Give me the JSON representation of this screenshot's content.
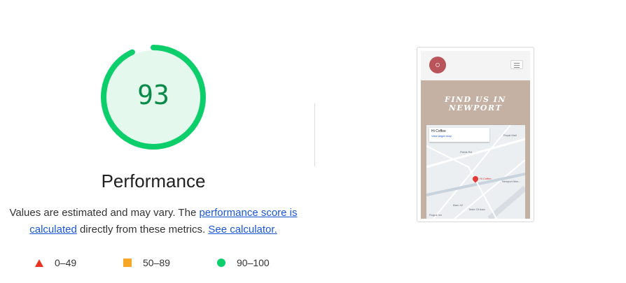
{
  "score": "93",
  "category_title": "Performance",
  "colors": {
    "pass": "#0cce6b",
    "pass_text": "#0a8a48",
    "pass_bg": "#e5f8ee",
    "average": "#f7a628",
    "fail": "#eb3323",
    "link": "#1a56d6"
  },
  "gauge": {
    "fraction": 0.93
  },
  "description": {
    "text_1": "Values are estimated and may vary. The ",
    "link_1": "performance score is calculated",
    "text_2": " directly from these metrics. ",
    "link_2": "See calculator."
  },
  "legend": [
    {
      "icon": "triangle-fail-icon",
      "label": "0–49"
    },
    {
      "icon": "square-average-icon",
      "label": "50–89"
    },
    {
      "icon": "circle-pass-icon",
      "label": "90–100"
    }
  ],
  "screenshot": {
    "hero_title_line1": "FIND US IN",
    "hero_title_line2": "NEWPORT",
    "map_card_title": "Hi Coffee",
    "map_card_link": "View larger map",
    "map_pin_label": "Hi Coffee",
    "map_labels": [
      "Royal Mail",
      "Fields Rd",
      "Newport Mar...",
      "Barn 42",
      "Taste Of Asia",
      "Rogue Ice"
    ]
  }
}
